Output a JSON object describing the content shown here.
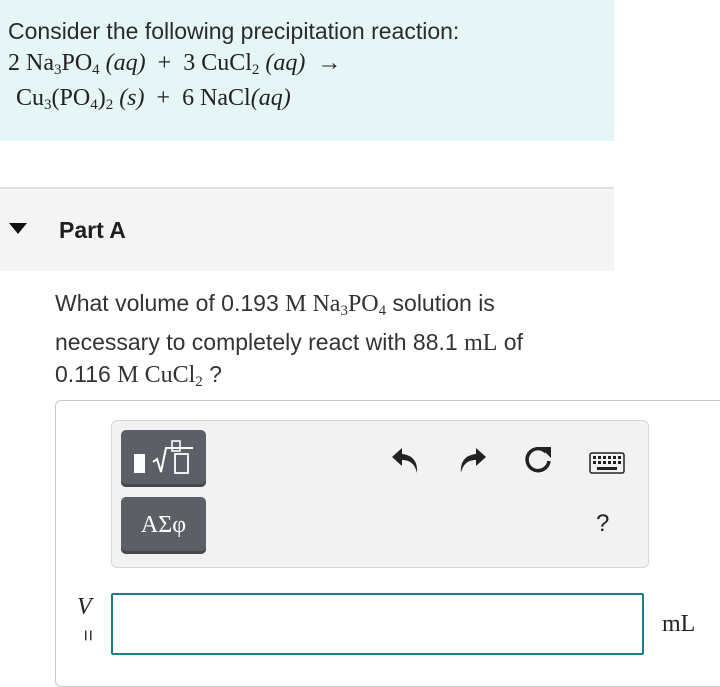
{
  "intro": {
    "text": "Consider the following precipitation reaction:",
    "reaction_line1": {
      "c1": "2",
      "f1a": "Na",
      "f1s1": "3",
      "f1b": "PO",
      "f1s2": "4",
      "st1": "(aq)",
      "plus": "+",
      "c2": "3",
      "f2a": "CuCl",
      "f2s1": "2",
      "st2": "(aq)",
      "arrow": "→"
    },
    "reaction_line2": {
      "f3a": "Cu",
      "f3s1": "3",
      "f3b": "(PO",
      "f3s2": "4",
      "f3c": ")",
      "f3s3": "2",
      "st3": "(s)",
      "plus": "+",
      "c4": "6",
      "f4": "NaCl",
      "st4": "(aq)"
    }
  },
  "part": {
    "label": "Part A"
  },
  "question": {
    "l1_pre": "What volume of 0.193 ",
    "l1_unit": "M",
    "l1_na": "Na",
    "l1_s1": "3",
    "l1_po": "PO",
    "l1_s2": "4",
    "l1_post": " solution is",
    "l2_pre": "necessary to completely react with 88.1 ",
    "l2_unit": "mL",
    "l2_post": " of",
    "l3_pre": "0.116 ",
    "l3_unit": "M",
    "l3_cu": "CuCl",
    "l3_s": "2",
    "l3_post": " ?"
  },
  "toolbar": {
    "symbols_label": "ΑΣφ",
    "help_label": "?",
    "icons": [
      "templates-icon",
      "undo-icon",
      "redo-icon",
      "reset-icon",
      "keyboard-icon"
    ]
  },
  "answer": {
    "variable": "V",
    "equals": "=",
    "value": "",
    "unit": "mL"
  },
  "colors": {
    "intro_bg": "#e6f5f5",
    "input_border": "#1a7f8a",
    "tool_button": "#5c6066"
  }
}
